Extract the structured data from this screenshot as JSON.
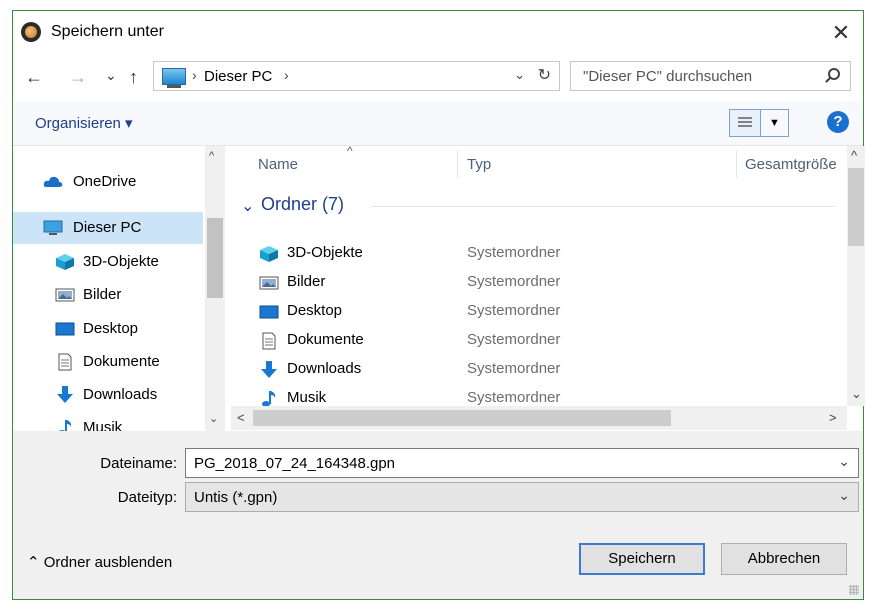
{
  "window": {
    "title": "Speichern unter",
    "close_glyph": "✕"
  },
  "nav": {
    "back_glyph": "←",
    "forward_glyph": "→",
    "recent_glyph": "⌄",
    "up_glyph": "↑",
    "address_sep": "›",
    "address_path": "Dieser PC",
    "address_dd_glyph": "⌄",
    "refresh_glyph": "↻",
    "search_placeholder": "\"Dieser PC\" durchsuchen"
  },
  "toolbar": {
    "organize_label": "Organisieren ▾",
    "view_dd_glyph": "▼",
    "help_glyph": "?"
  },
  "sidebar": {
    "items": [
      {
        "label": "OneDrive",
        "icon": "cloud-icon",
        "selected": false
      },
      {
        "label": "Dieser PC",
        "icon": "pc-icon",
        "selected": true
      },
      {
        "label": "3D-Objekte",
        "icon": "cube-icon",
        "selected": false
      },
      {
        "label": "Bilder",
        "icon": "pictures-icon",
        "selected": false
      },
      {
        "label": "Desktop",
        "icon": "desktop-icon",
        "selected": false
      },
      {
        "label": "Dokumente",
        "icon": "document-icon",
        "selected": false
      },
      {
        "label": "Downloads",
        "icon": "download-icon",
        "selected": false
      },
      {
        "label": "Musik",
        "icon": "music-icon",
        "selected": false
      }
    ]
  },
  "content": {
    "columns": {
      "name": "Name",
      "type": "Typ",
      "size": "Gesamtgröße"
    },
    "sort_glyph": "^",
    "group_label": "Ordner (7)",
    "group_chevron": "⌄",
    "rows": [
      {
        "name": "3D-Objekte",
        "type": "Systemordner",
        "icon": "cube-icon"
      },
      {
        "name": "Bilder",
        "type": "Systemordner",
        "icon": "pictures-icon"
      },
      {
        "name": "Desktop",
        "type": "Systemordner",
        "icon": "desktop-icon"
      },
      {
        "name": "Dokumente",
        "type": "Systemordner",
        "icon": "document-icon"
      },
      {
        "name": "Downloads",
        "type": "Systemordner",
        "icon": "download-icon"
      },
      {
        "name": "Musik",
        "type": "Systemordner",
        "icon": "music-icon"
      }
    ]
  },
  "scroll_glyphs": {
    "up": "^",
    "down": "⌄",
    "left": "<",
    "right": ">"
  },
  "form": {
    "filename_label": "Dateiname:",
    "filename_value": "PG_2018_07_24_164348.gpn",
    "filetype_label": "Dateityp:",
    "filetype_value": "Untis (*.gpn)",
    "dd_glyph": "⌄"
  },
  "footer": {
    "hide_folders_label": "⌃ Ordner ausblenden",
    "save_label": "Speichern",
    "cancel_label": "Abbrechen"
  },
  "colors": {
    "accent": "#1e3f8a",
    "selection": "#cce4f7",
    "border": "#3c8a3c"
  }
}
